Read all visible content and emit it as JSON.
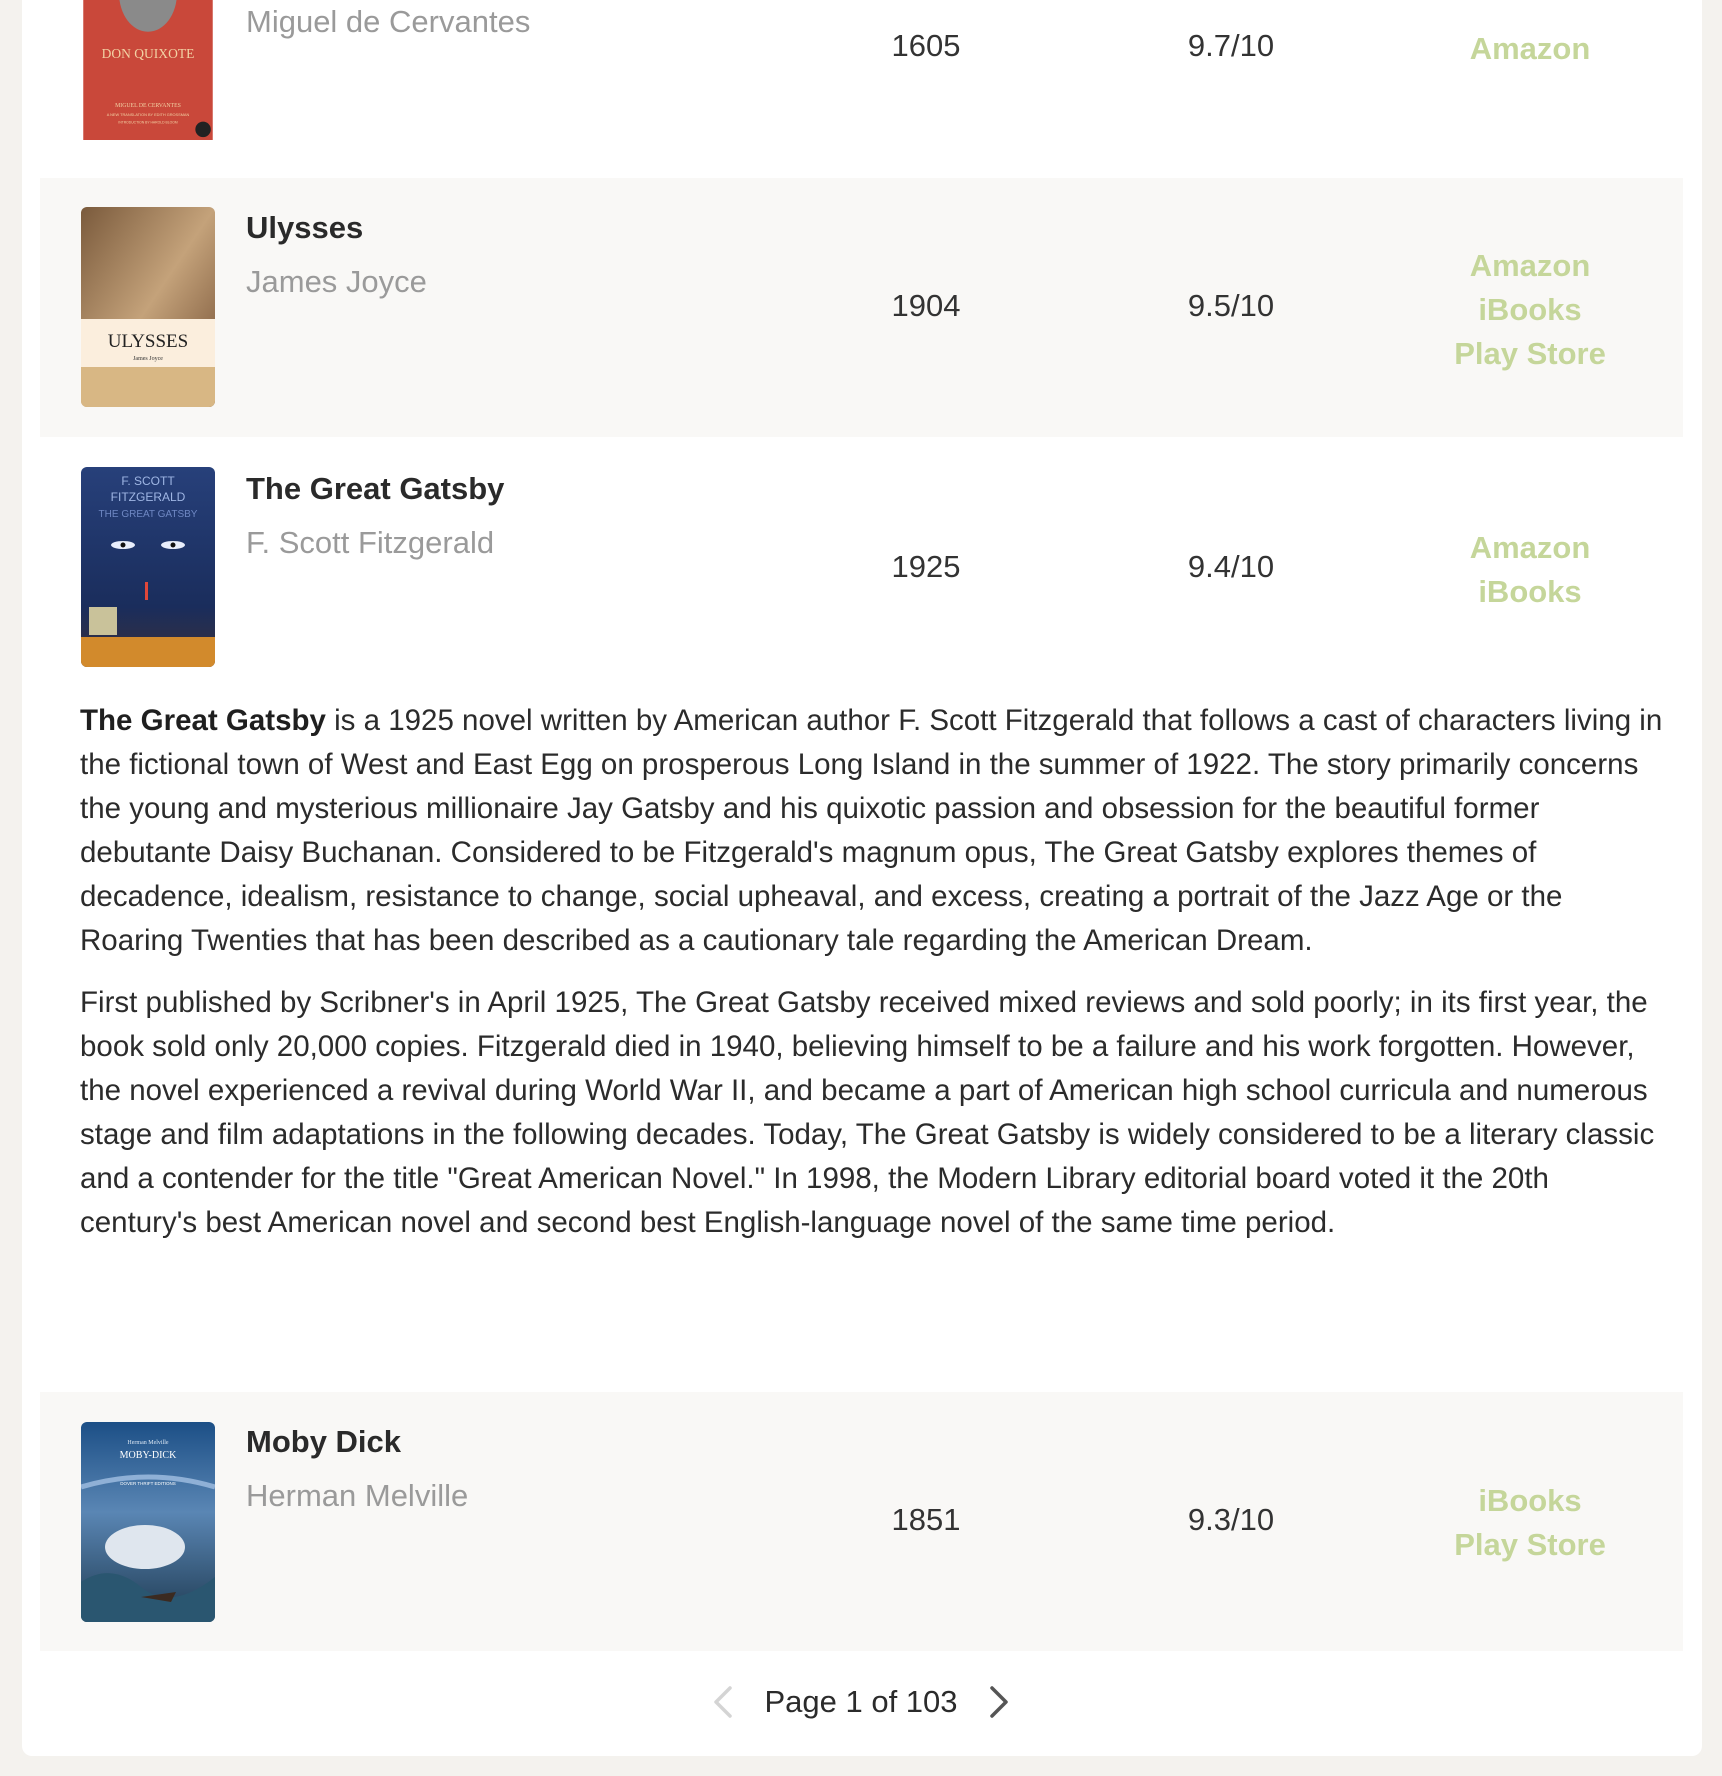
{
  "books": [
    {
      "id": "don-quixote",
      "title": "",
      "author": "Miguel de Cervantes",
      "year": "1605",
      "rating": "9.7/10",
      "stores": [
        "Amazon"
      ],
      "cover_text": [
        "DON QUIXOTE",
        "MIGUEL DE CERVANTES",
        "A NEW TRANSLATION BY EDITH GROSSMAN",
        "INTRODUCTION BY HAROLD BLOOM"
      ]
    },
    {
      "id": "ulysses",
      "title": "Ulysses",
      "author": "James Joyce",
      "year": "1904",
      "rating": "9.5/10",
      "stores": [
        "Amazon",
        "iBooks",
        "Play Store"
      ],
      "cover_text": [
        "ULYSSES",
        "James Joyce"
      ]
    },
    {
      "id": "great-gatsby",
      "title": "The Great Gatsby",
      "author": "F. Scott Fitzgerald",
      "year": "1925",
      "rating": "9.4/10",
      "stores": [
        "Amazon",
        "iBooks"
      ],
      "cover_text": [
        "F. SCOTT",
        "FITZGERALD",
        "THE GREAT GATSBY"
      ],
      "description": {
        "lead_bold": "The Great Gatsby",
        "p1_rest": " is a 1925 novel written by American author F. Scott Fitzgerald that follows a cast of characters living in the fictional town of West and East Egg on prosperous Long Island in the summer of 1922. The story primarily concerns the young and mysterious millionaire Jay Gatsby and his quixotic passion and obsession for the beautiful former debutante Daisy Buchanan. Considered to be Fitzgerald's magnum opus, The Great Gatsby explores themes of decadence, idealism, resistance to change, social upheaval, and excess, creating a portrait of the Jazz Age or the Roaring Twenties that has been described as a cautionary tale regarding the American Dream.",
        "p2": "First published by Scribner's in April 1925, The Great Gatsby received mixed reviews and sold poorly; in its first year, the book sold only 20,000 copies. Fitzgerald died in 1940, believing himself to be a failure and his work forgotten. However, the novel experienced a revival during World War II, and became a part of American high school curricula and numerous stage and film adaptations in the following decades. Today, The Great Gatsby is widely considered to be a literary classic and a contender for the title \"Great American Novel.\" In 1998, the Modern Library editorial board voted it the 20th century's best American novel and second best English-language novel of the same time period."
      }
    },
    {
      "id": "moby-dick",
      "title": "Moby Dick",
      "author": "Herman Melville",
      "year": "1851",
      "rating": "9.3/10",
      "stores": [
        "iBooks",
        "Play Store"
      ],
      "cover_text": [
        "Herman Melville",
        "MOBY-DICK",
        "DOVER THRIFT EDITIONS"
      ]
    }
  ],
  "pagination": {
    "label": "Page 1 of 103",
    "prev_icon": "chevron-left-icon",
    "next_icon": "chevron-right-icon"
  },
  "colors": {
    "store_link": "#c5d69a",
    "author": "#9a9a9a",
    "row_shade": "#f9f8f6",
    "page_bg": "#f4f2ee"
  }
}
